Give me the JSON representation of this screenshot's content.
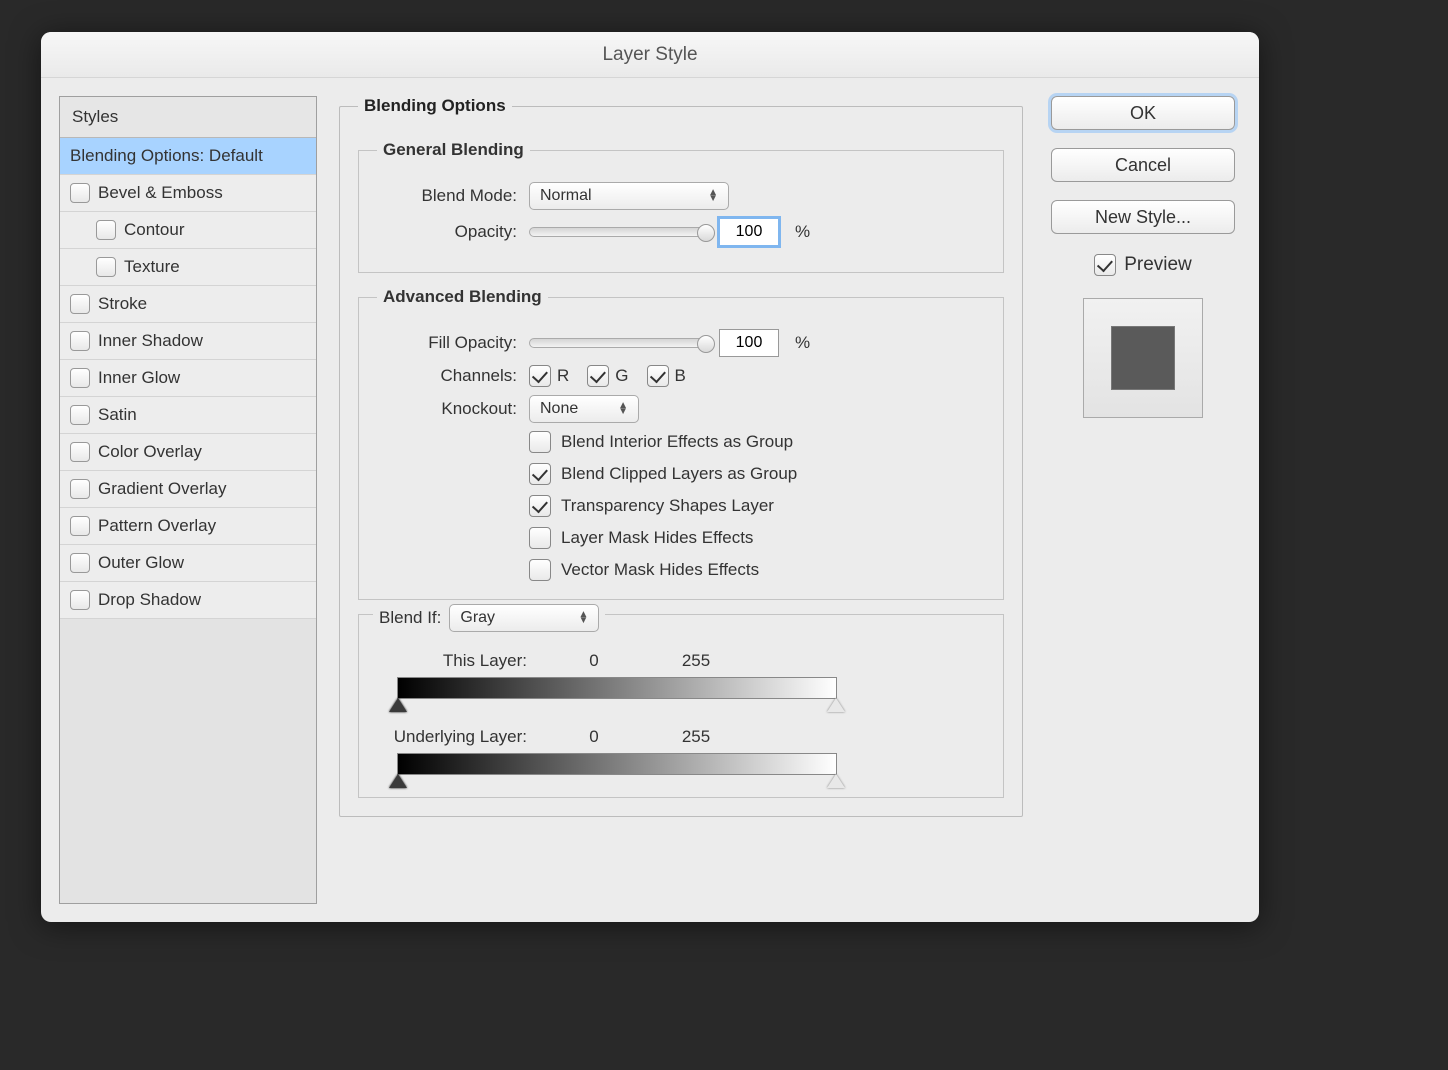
{
  "dialog": {
    "title": "Layer Style"
  },
  "sidebar": {
    "header": "Styles",
    "items": [
      {
        "label": "Blending Options: Default",
        "checkbox": false,
        "selected": true,
        "sub": false
      },
      {
        "label": "Bevel & Emboss",
        "checkbox": true,
        "selected": false,
        "sub": false
      },
      {
        "label": "Contour",
        "checkbox": true,
        "selected": false,
        "sub": true
      },
      {
        "label": "Texture",
        "checkbox": true,
        "selected": false,
        "sub": true
      },
      {
        "label": "Stroke",
        "checkbox": true,
        "selected": false,
        "sub": false
      },
      {
        "label": "Inner Shadow",
        "checkbox": true,
        "selected": false,
        "sub": false
      },
      {
        "label": "Inner Glow",
        "checkbox": true,
        "selected": false,
        "sub": false
      },
      {
        "label": "Satin",
        "checkbox": true,
        "selected": false,
        "sub": false
      },
      {
        "label": "Color Overlay",
        "checkbox": true,
        "selected": false,
        "sub": false
      },
      {
        "label": "Gradient Overlay",
        "checkbox": true,
        "selected": false,
        "sub": false
      },
      {
        "label": "Pattern Overlay",
        "checkbox": true,
        "selected": false,
        "sub": false
      },
      {
        "label": "Outer Glow",
        "checkbox": true,
        "selected": false,
        "sub": false
      },
      {
        "label": "Drop Shadow",
        "checkbox": true,
        "selected": false,
        "sub": false
      }
    ]
  },
  "blending": {
    "section_title": "Blending Options",
    "general": {
      "title": "General Blending",
      "blend_mode_label": "Blend Mode:",
      "blend_mode_value": "Normal",
      "opacity_label": "Opacity:",
      "opacity_value": "100",
      "opacity_unit": "%"
    },
    "advanced": {
      "title": "Advanced Blending",
      "fill_opacity_label": "Fill Opacity:",
      "fill_opacity_value": "100",
      "fill_opacity_unit": "%",
      "channels_label": "Channels:",
      "channel_r": "R",
      "channel_g": "G",
      "channel_b": "B",
      "channel_r_checked": true,
      "channel_g_checked": true,
      "channel_b_checked": true,
      "knockout_label": "Knockout:",
      "knockout_value": "None",
      "options": [
        {
          "label": "Blend Interior Effects as Group",
          "checked": false
        },
        {
          "label": "Blend Clipped Layers as Group",
          "checked": true
        },
        {
          "label": "Transparency Shapes Layer",
          "checked": true
        },
        {
          "label": "Layer Mask Hides Effects",
          "checked": false
        },
        {
          "label": "Vector Mask Hides Effects",
          "checked": false
        }
      ]
    },
    "blend_if": {
      "label": "Blend If:",
      "value": "Gray",
      "this_layer_label": "This Layer:",
      "this_layer_low": "0",
      "this_layer_high": "255",
      "underlying_label": "Underlying Layer:",
      "underlying_low": "0",
      "underlying_high": "255"
    }
  },
  "buttons": {
    "ok": "OK",
    "cancel": "Cancel",
    "new_style": "New Style...",
    "preview_label": "Preview",
    "preview_checked": true
  }
}
